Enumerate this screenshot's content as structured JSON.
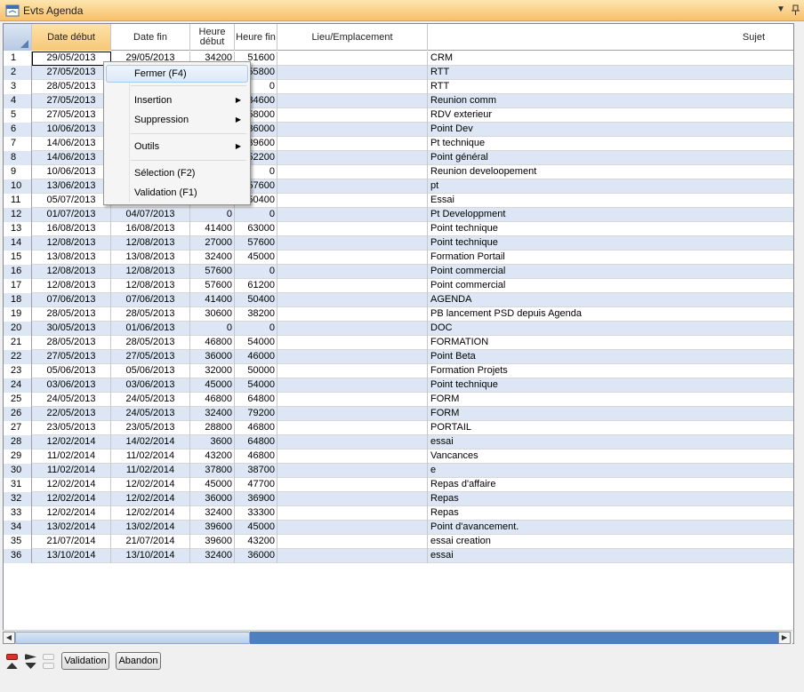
{
  "window": {
    "title": "Evts Agenda",
    "pin_icon": "pin-icon",
    "dropdown_icon": "chevron-down-icon"
  },
  "columns": {
    "date_debut": "Date début",
    "date_fin": "Date fin",
    "heure_debut": "Heure début",
    "heure_fin": "Heure fin",
    "lieu": "Lieu/Emplacement",
    "sujet": "Sujet"
  },
  "rows": [
    {
      "n": "1",
      "d1": "29/05/2013",
      "d2": "29/05/2013",
      "h1": "34200",
      "h2": "51600",
      "lieu": "",
      "sujet": "CRM"
    },
    {
      "n": "2",
      "d1": "27/05/2013",
      "d2": "",
      "h1": "",
      "h2": "55800",
      "lieu": "",
      "sujet": "RTT"
    },
    {
      "n": "3",
      "d1": "28/05/2013",
      "d2": "",
      "h1": "",
      "h2": "0",
      "lieu": "",
      "sujet": "RTT"
    },
    {
      "n": "4",
      "d1": "27/05/2013",
      "d2": "",
      "h1": "",
      "h2": "34600",
      "lieu": "",
      "sujet": "Reunion comm"
    },
    {
      "n": "5",
      "d1": "27/05/2013",
      "d2": "",
      "h1": "",
      "h2": "58000",
      "lieu": "",
      "sujet": "RDV exterieur"
    },
    {
      "n": "6",
      "d1": "10/06/2013",
      "d2": "",
      "h1": "",
      "h2": "36000",
      "lieu": "",
      "sujet": "Point Dev"
    },
    {
      "n": "7",
      "d1": "14/06/2013",
      "d2": "",
      "h1": "",
      "h2": "39600",
      "lieu": "",
      "sujet": "Pt technique"
    },
    {
      "n": "8",
      "d1": "14/06/2013",
      "d2": "",
      "h1": "",
      "h2": "52200",
      "lieu": "",
      "sujet": "Point général"
    },
    {
      "n": "9",
      "d1": "10/06/2013",
      "d2": "",
      "h1": "",
      "h2": "0",
      "lieu": "",
      "sujet": "Reunion develoopement"
    },
    {
      "n": "10",
      "d1": "13/06/2013",
      "d2": "",
      "h1": "",
      "h2": "57600",
      "lieu": "",
      "sujet": "pt"
    },
    {
      "n": "11",
      "d1": "05/07/2013",
      "d2": "",
      "h1": "",
      "h2": "50400",
      "lieu": "",
      "sujet": "Essai"
    },
    {
      "n": "12",
      "d1": "01/07/2013",
      "d2": "04/07/2013",
      "h1": "0",
      "h2": "0",
      "lieu": "",
      "sujet": "Pt Developpment"
    },
    {
      "n": "13",
      "d1": "16/08/2013",
      "d2": "16/08/2013",
      "h1": "41400",
      "h2": "63000",
      "lieu": "",
      "sujet": "Point technique"
    },
    {
      "n": "14",
      "d1": "12/08/2013",
      "d2": "12/08/2013",
      "h1": "27000",
      "h2": "57600",
      "lieu": "",
      "sujet": "Point technique"
    },
    {
      "n": "15",
      "d1": "13/08/2013",
      "d2": "13/08/2013",
      "h1": "32400",
      "h2": "45000",
      "lieu": "",
      "sujet": "Formation Portail"
    },
    {
      "n": "16",
      "d1": "12/08/2013",
      "d2": "12/08/2013",
      "h1": "57600",
      "h2": "0",
      "lieu": "",
      "sujet": "Point commercial"
    },
    {
      "n": "17",
      "d1": "12/08/2013",
      "d2": "12/08/2013",
      "h1": "57600",
      "h2": "61200",
      "lieu": "",
      "sujet": "Point commercial"
    },
    {
      "n": "18",
      "d1": "07/06/2013",
      "d2": "07/06/2013",
      "h1": "41400",
      "h2": "50400",
      "lieu": "",
      "sujet": "AGENDA"
    },
    {
      "n": "19",
      "d1": "28/05/2013",
      "d2": "28/05/2013",
      "h1": "30600",
      "h2": "38200",
      "lieu": "",
      "sujet": "PB lancement PSD depuis Agenda"
    },
    {
      "n": "20",
      "d1": "30/05/2013",
      "d2": "01/06/2013",
      "h1": "0",
      "h2": "0",
      "lieu": "",
      "sujet": "DOC"
    },
    {
      "n": "21",
      "d1": "28/05/2013",
      "d2": "28/05/2013",
      "h1": "46800",
      "h2": "54000",
      "lieu": "",
      "sujet": "FORMATION"
    },
    {
      "n": "22",
      "d1": "27/05/2013",
      "d2": "27/05/2013",
      "h1": "36000",
      "h2": "46000",
      "lieu": "",
      "sujet": "Point Beta"
    },
    {
      "n": "23",
      "d1": "05/06/2013",
      "d2": "05/06/2013",
      "h1": "32000",
      "h2": "50000",
      "lieu": "",
      "sujet": "Formation Projets"
    },
    {
      "n": "24",
      "d1": "03/06/2013",
      "d2": "03/06/2013",
      "h1": "45000",
      "h2": "54000",
      "lieu": "",
      "sujet": "Point technique"
    },
    {
      "n": "25",
      "d1": "24/05/2013",
      "d2": "24/05/2013",
      "h1": "46800",
      "h2": "64800",
      "lieu": "",
      "sujet": "FORM"
    },
    {
      "n": "26",
      "d1": "22/05/2013",
      "d2": "24/05/2013",
      "h1": "32400",
      "h2": "79200",
      "lieu": "",
      "sujet": "FORM"
    },
    {
      "n": "27",
      "d1": "23/05/2013",
      "d2": "23/05/2013",
      "h1": "28800",
      "h2": "46800",
      "lieu": "",
      "sujet": "PORTAIL"
    },
    {
      "n": "28",
      "d1": "12/02/2014",
      "d2": "14/02/2014",
      "h1": "3600",
      "h2": "64800",
      "lieu": "",
      "sujet": "essai"
    },
    {
      "n": "29",
      "d1": "11/02/2014",
      "d2": "11/02/2014",
      "h1": "43200",
      "h2": "46800",
      "lieu": "",
      "sujet": "Vancances"
    },
    {
      "n": "30",
      "d1": "11/02/2014",
      "d2": "11/02/2014",
      "h1": "37800",
      "h2": "38700",
      "lieu": "",
      "sujet": "e"
    },
    {
      "n": "31",
      "d1": "12/02/2014",
      "d2": "12/02/2014",
      "h1": "45000",
      "h2": "47700",
      "lieu": "",
      "sujet": "Repas d'affaire"
    },
    {
      "n": "32",
      "d1": "12/02/2014",
      "d2": "12/02/2014",
      "h1": "36000",
      "h2": "36900",
      "lieu": "",
      "sujet": "Repas"
    },
    {
      "n": "33",
      "d1": "12/02/2014",
      "d2": "12/02/2014",
      "h1": "32400",
      "h2": "33300",
      "lieu": "",
      "sujet": "Repas"
    },
    {
      "n": "34",
      "d1": "13/02/2014",
      "d2": "13/02/2014",
      "h1": "39600",
      "h2": "45000",
      "lieu": "",
      "sujet": "Point d'avancement."
    },
    {
      "n": "35",
      "d1": "21/07/2014",
      "d2": "21/07/2014",
      "h1": "39600",
      "h2": "43200",
      "lieu": "",
      "sujet": "essai creation"
    },
    {
      "n": "36",
      "d1": "13/10/2014",
      "d2": "13/10/2014",
      "h1": "32400",
      "h2": "36000",
      "lieu": "",
      "sujet": "essai"
    }
  ],
  "context_menu": {
    "fermer": "Fermer (F4)",
    "insertion": "Insertion",
    "suppression": "Suppression",
    "outils": "Outils",
    "selection": "Sélection (F2)",
    "validation": "Validation (F1)",
    "submenu_icon": "triangle-right-icon"
  },
  "footer": {
    "validation": "Validation",
    "abandon": "Abandon"
  },
  "colors": {
    "titlebar": "#f8c06a",
    "sorted_header": "#f7c879",
    "alt_row": "#dce6f4",
    "scroll_track": "#4f7fbf"
  }
}
